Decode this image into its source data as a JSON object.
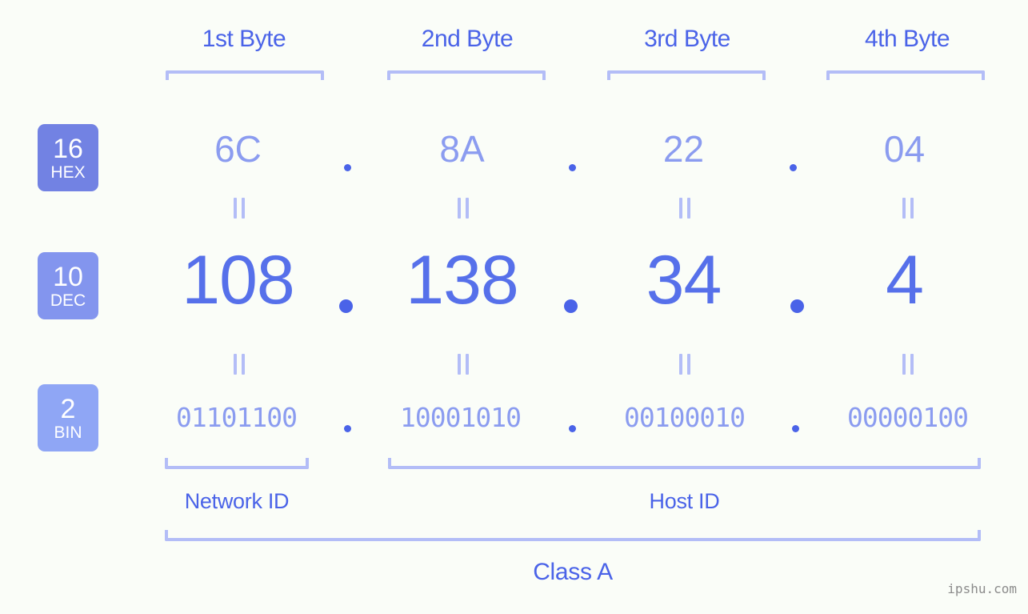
{
  "background_color": "#fafdf8",
  "accent_colors": {
    "primary_text": "#4a63e8",
    "value_dec": "#5670ea",
    "value_light": "#8b9cf0",
    "bracket": "#b3bdf7",
    "badge_hex": "#7282e3",
    "badge_dec": "#8395ee",
    "badge_bin": "#8fa6f5",
    "watermark": "#8b8b8b"
  },
  "byte_headers": [
    {
      "label": "1st Byte"
    },
    {
      "label": "2nd Byte"
    },
    {
      "label": "3rd Byte"
    },
    {
      "label": "4th Byte"
    }
  ],
  "radix_badges": [
    {
      "num": "16",
      "name": "HEX"
    },
    {
      "num": "10",
      "name": "DEC"
    },
    {
      "num": "2",
      "name": "BIN"
    }
  ],
  "rows": {
    "hex": {
      "values": [
        "6C",
        "8A",
        "22",
        "04"
      ],
      "separator": "."
    },
    "dec": {
      "values": [
        "108",
        "138",
        "34",
        "4"
      ],
      "separator": "."
    },
    "bin": {
      "values": [
        "01101100",
        "10001010",
        "00100010",
        "00000100"
      ],
      "separator": "."
    }
  },
  "equals_marks": {
    "symbol": "=",
    "count_per_row": 4,
    "rows": 2
  },
  "segments": [
    {
      "label": "Network ID"
    },
    {
      "label": "Host ID"
    }
  ],
  "class_label": "Class A",
  "watermark": "ipshu.com"
}
